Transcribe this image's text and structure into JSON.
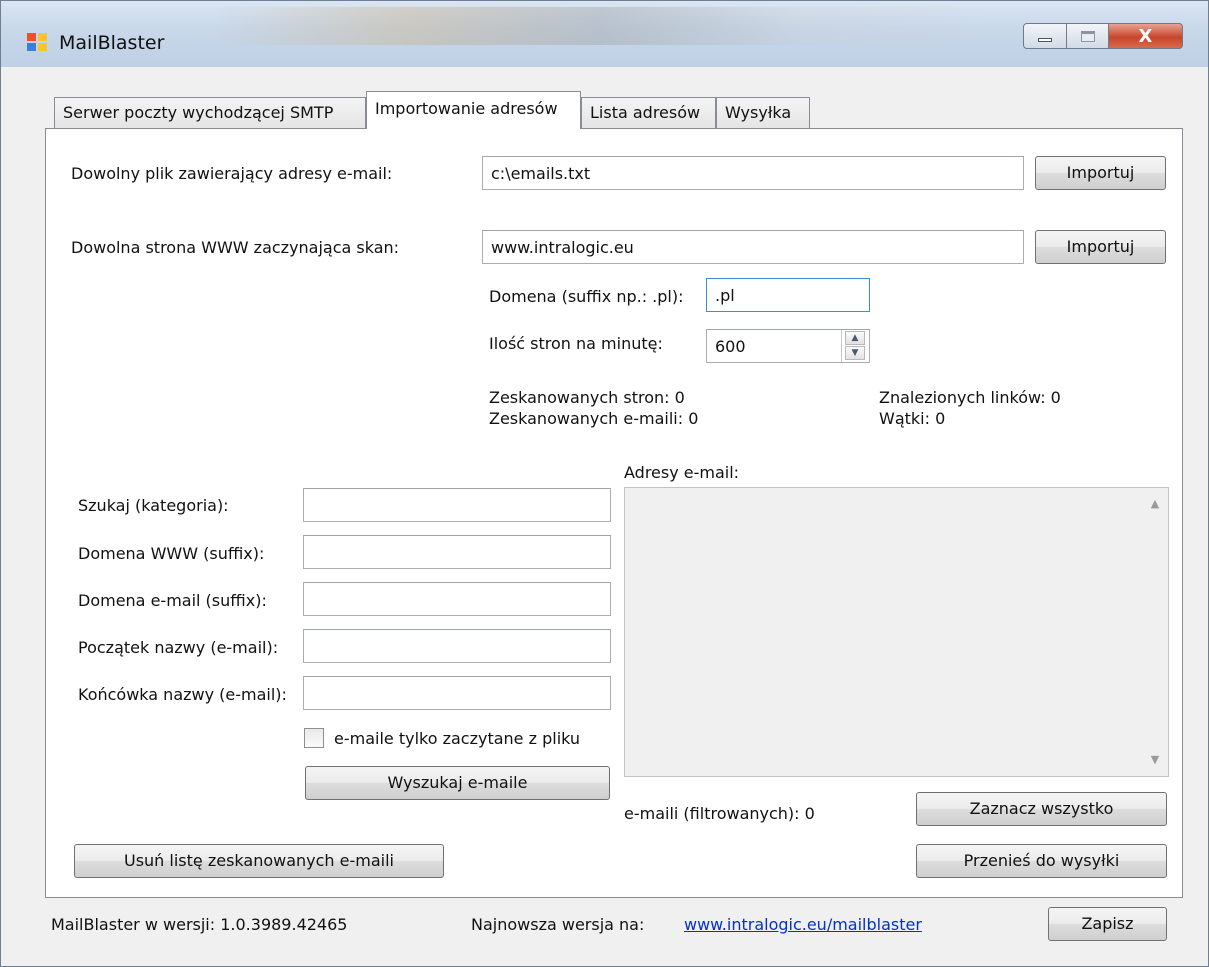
{
  "window": {
    "title": "MailBlaster",
    "close_glyph": "X",
    "colors": {
      "titlebar": "#c9d8ea",
      "close_button": "#c8452c",
      "link": "#0033cc"
    }
  },
  "tabs": [
    {
      "label": "Serwer poczty wychodzącej SMTP",
      "active": false
    },
    {
      "label": "Importowanie adresów",
      "active": true
    },
    {
      "label": "Lista adresów",
      "active": false
    },
    {
      "label": "Wysyłka",
      "active": false
    }
  ],
  "import_file": {
    "label": "Dowolny plik zawierający adresy e-mail:",
    "value": "c:\\emails.txt",
    "button": "Importuj"
  },
  "import_web": {
    "label": "Dowolna strona WWW zaczynająca skan:",
    "value": "www.intralogic.eu",
    "button": "Importuj",
    "domain_label": "Domena (suffix np.: .pl):",
    "domain_value": ".pl",
    "rate_label": "Ilość stron na minutę:",
    "rate_value": "600"
  },
  "stats": {
    "scanned_pages": "Zeskanowanych stron: 0",
    "scanned_emails": "Zeskanowanych e-maili: 0",
    "found_links": "Znalezionych linków: 0",
    "threads": "Wątki: 0"
  },
  "filters": {
    "category_label": "Szukaj (kategoria):",
    "www_domain_label": "Domena WWW (suffix):",
    "email_domain_label": "Domena e-mail (suffix):",
    "name_start_label": "Początek nazwy (e-mail):",
    "name_end_label": "Końcówka nazwy (e-mail):",
    "file_only_label": "e-maile tylko zaczytane z pliku",
    "file_only_checked": false,
    "search_button": "Wyszukaj e-maile"
  },
  "addresses": {
    "label": "Adresy e-mail:",
    "filtered_count": "e-maili (filtrowanych): 0",
    "select_all_button": "Zaznacz wszystko",
    "move_button": "Przenieś do wysyłki"
  },
  "clear_button": "Usuń listę zeskanowanych e-maili",
  "footer": {
    "version": "MailBlaster w wersji: 1.0.3989.42465",
    "newest_label": "Najnowsza wersja na:",
    "newest_link": "www.intralogic.eu/mailblaster",
    "save_button": "Zapisz"
  }
}
